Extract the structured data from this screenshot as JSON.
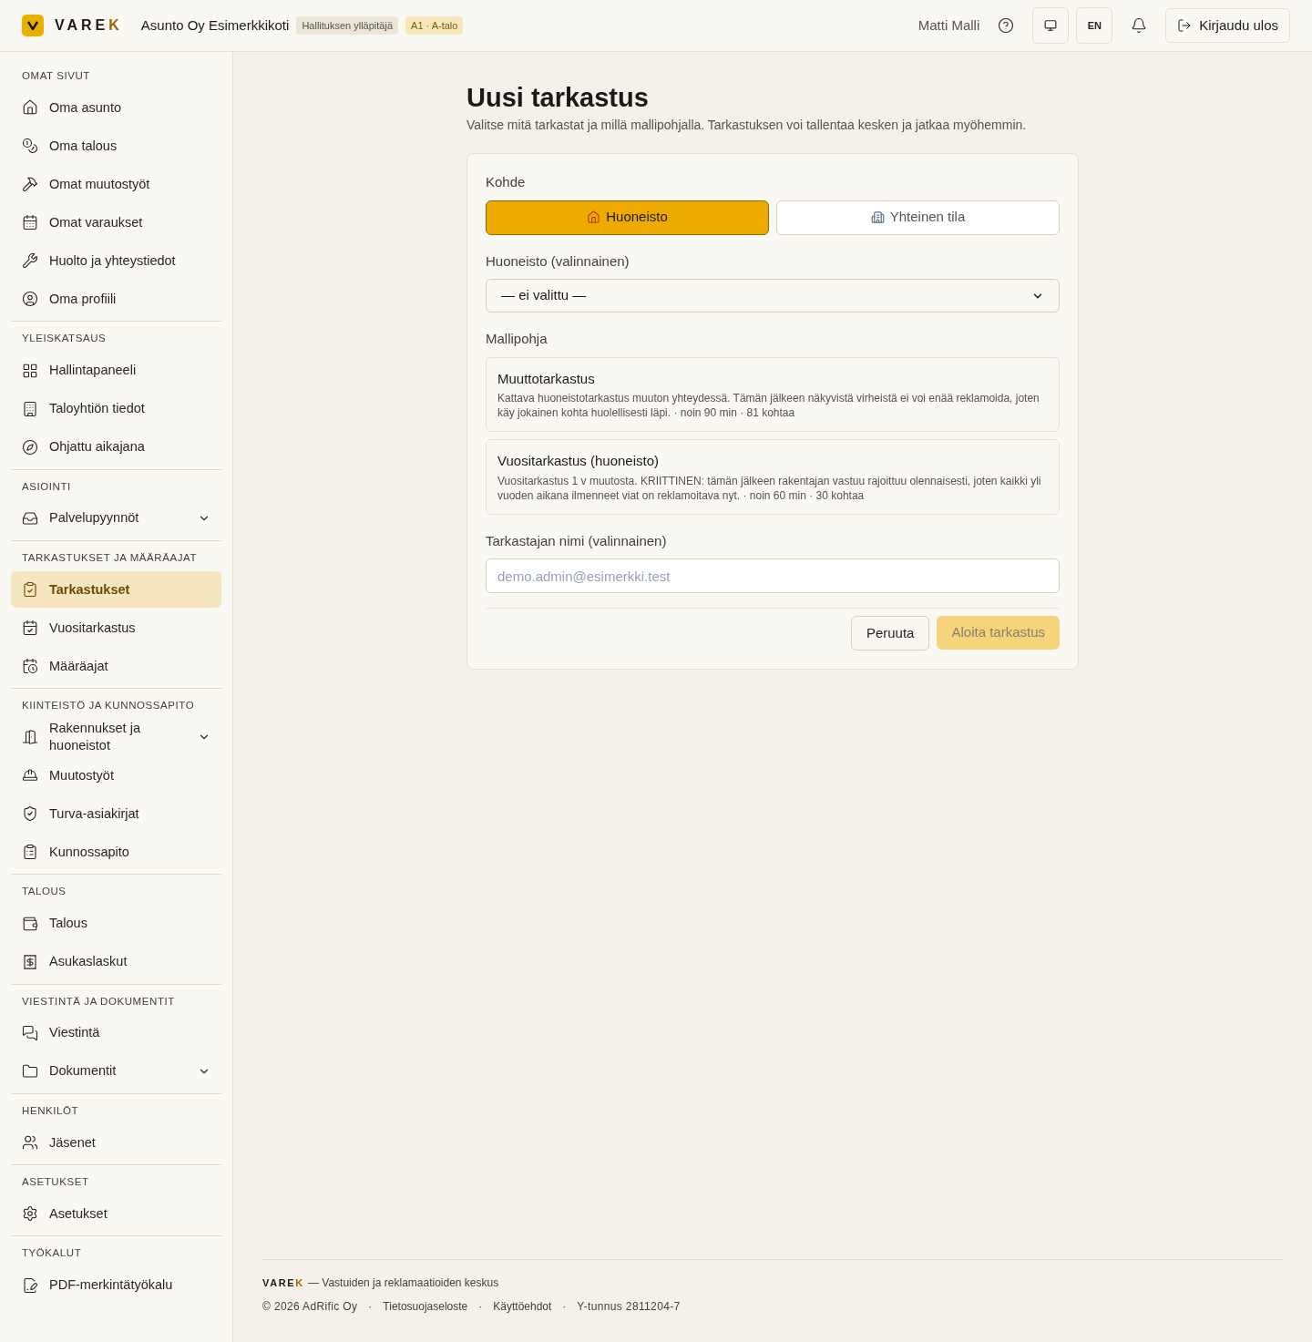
{
  "header": {
    "brand": {
      "main": "VARE",
      "accent": "K"
    },
    "org": "Asunto Oy Esimerkkikoti",
    "badges": [
      {
        "text": "Hallituksen ylläpitäjä",
        "kind": "role"
      },
      {
        "text": "A1 · A-talo",
        "kind": "unit"
      }
    ],
    "user": "Matti Malli",
    "language": "EN",
    "logout": "Kirjaudu ulos"
  },
  "sidebar": {
    "sections": [
      {
        "title": "OMAT SIVUT",
        "items": [
          {
            "label": "Oma asunto",
            "selected": false
          },
          {
            "label": "Oma talous",
            "selected": false
          },
          {
            "label": "Omat muutostyöt",
            "selected": false
          },
          {
            "label": "Omat varaukset",
            "selected": false
          },
          {
            "label": "Huolto ja yhteystiedot",
            "selected": false
          },
          {
            "label": "Oma profiili",
            "selected": false
          }
        ]
      },
      {
        "title": "YLEISKATSAUS",
        "items": [
          {
            "label": "Hallintapaneeli",
            "selected": false
          },
          {
            "label": "Taloyhtiön tiedot",
            "selected": false
          },
          {
            "label": "Ohjattu aikajana",
            "selected": false
          }
        ]
      },
      {
        "title": "ASIOINTI",
        "items": [
          {
            "label": "Palvelupyynnöt",
            "selected": false,
            "expandable": true
          }
        ]
      },
      {
        "title": "TARKASTUKSET JA MÄÄRÄAJAT",
        "items": [
          {
            "label": "Tarkastukset",
            "selected": true
          },
          {
            "label": "Vuositarkastus",
            "selected": false
          },
          {
            "label": "Määräajat",
            "selected": false
          }
        ]
      },
      {
        "title": "KIINTEISTÖ JA KUNNOSSAPITO",
        "items": [
          {
            "label": "Rakennukset ja huoneistot",
            "selected": false,
            "expandable": true
          },
          {
            "label": "Muutostyöt",
            "selected": false
          },
          {
            "label": "Turva-asiakirjat",
            "selected": false
          },
          {
            "label": "Kunnossapito",
            "selected": false
          }
        ]
      },
      {
        "title": "TALOUS",
        "items": [
          {
            "label": "Talous",
            "selected": false
          },
          {
            "label": "Asukaslaskut",
            "selected": false
          }
        ]
      },
      {
        "title": "VIESTINTÄ JA DOKUMENTIT",
        "items": [
          {
            "label": "Viestintä",
            "selected": false
          },
          {
            "label": "Dokumentit",
            "selected": false,
            "expandable": true
          }
        ]
      },
      {
        "title": "HENKILÖT",
        "items": [
          {
            "label": "Jäsenet",
            "selected": false
          }
        ]
      },
      {
        "title": "ASETUKSET",
        "items": [
          {
            "label": "Asetukset",
            "selected": false
          }
        ]
      },
      {
        "title": "TYÖKALUT",
        "items": [
          {
            "label": "PDF-merkintätyökalu",
            "selected": false
          }
        ]
      }
    ]
  },
  "page": {
    "title": "Uusi tarkastus",
    "subtitle": "Valitse mitä tarkastat ja millä mallipohjalla. Tarkastuksen voi tallentaa kesken ja jatkaa myöhemmin.",
    "target": {
      "label": "Kohde",
      "options": [
        {
          "label": "Huoneisto",
          "selected": true
        },
        {
          "label": "Yhteinen tila",
          "selected": false
        }
      ]
    },
    "apartment": {
      "label": "Huoneisto (valinnainen)",
      "value": "— ei valittu —"
    },
    "template": {
      "label": "Mallipohja",
      "options": [
        {
          "title": "Muuttotarkastus",
          "description": "Kattava huoneistotarkastus muuton yhteydessä. Tämän jälkeen näkyvistä virheistä ei voi enää reklamoida, joten käy jokainen kohta huolellisesti läpi. · noin 90 min · 81 kohtaa",
          "selected": false
        },
        {
          "title": "Vuositarkastus (huoneisto)",
          "description": "Vuositarkastus 1 v muutosta. KRIITTINEN: tämän jälkeen rakentajan vastuu rajoittuu olennaisesti, joten kaikki yli vuoden aikana ilmenneet viat on reklamoitava nyt. · noin 60 min · 30 kohtaa",
          "selected": false
        }
      ]
    },
    "inspector": {
      "label": "Tarkastajan nimi (valinnainen)",
      "placeholder": "demo.admin@esimerkki.test"
    },
    "cancel": "Peruuta",
    "submit": {
      "label": "Aloita tarkastus",
      "disabled": true
    }
  },
  "footer": {
    "brand": {
      "main": "VARE",
      "accent": "K"
    },
    "tagline": "— Vastuiden ja reklamaatioiden keskus",
    "legal": [
      {
        "text": "© 2026 AdRific Oy",
        "kind": "text"
      },
      {
        "text": "·",
        "kind": "separator"
      },
      {
        "text": "Tietosuojaseloste",
        "kind": "link"
      },
      {
        "text": "·",
        "kind": "separator"
      },
      {
        "text": "Käyttöehdot",
        "kind": "link"
      },
      {
        "text": "·",
        "kind": "separator"
      },
      {
        "text": "Y-tunnus 2811204-7",
        "kind": "text"
      }
    ]
  }
}
